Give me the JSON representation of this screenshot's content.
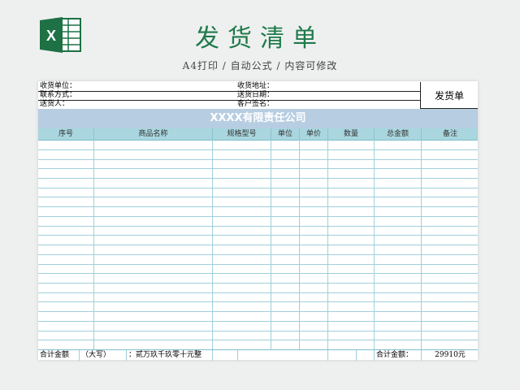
{
  "page": {
    "title": "发货清单",
    "subtitle": "A4打印 / 自动公式 / 内容可修改"
  },
  "logo": {
    "icon": "excel-logo-icon",
    "letter": "X",
    "color": "#1e7145"
  },
  "form": {
    "receiver_unit_label": "收货单位：",
    "receiver_address_label": "收货地址：",
    "contact_label": "联系方式：",
    "delivery_date_label": "送货日期：",
    "deliverer_label": "送货人：",
    "customer_sign_label": "客户签名：",
    "badge": "发货单"
  },
  "company_banner": "XXXX有限责任公司",
  "table": {
    "columns": [
      "序号",
      "商品名称",
      "规格型号",
      "单位",
      "单价",
      "数量",
      "总金额",
      "备注"
    ],
    "empty_rows": 22
  },
  "footer": {
    "total_label": "合计金额",
    "capital_label": "（大写）",
    "capital_value": "：贰万玖千玖零十元整",
    "total_label2": "合计金额：",
    "total_value": "29910元"
  },
  "colors": {
    "title": "#1f7a4a",
    "banner": "#b7cde2",
    "header": "#a9d6df",
    "grid": "#9fd0d9"
  }
}
